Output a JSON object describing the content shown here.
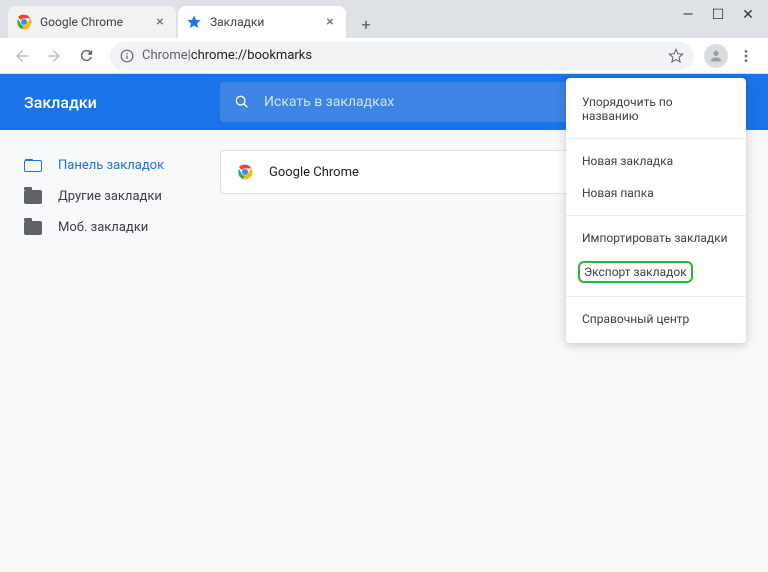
{
  "tabs": [
    {
      "title": "Google Chrome",
      "active": false
    },
    {
      "title": "Закладки",
      "active": true
    }
  ],
  "omnibox": {
    "prefix": "Chrome",
    "separator": " | ",
    "path": "chrome://bookmarks"
  },
  "bookmarksPage": {
    "title": "Закладки",
    "searchPlaceholder": "Искать в закладках"
  },
  "sidebar": {
    "items": [
      {
        "label": "Панель закладок",
        "active": true
      },
      {
        "label": "Другие закладки",
        "active": false
      },
      {
        "label": "Моб. закладки",
        "active": false
      }
    ]
  },
  "bookmarkList": [
    {
      "title": "Google Chrome"
    }
  ],
  "menu": {
    "sortByName": "Упорядочить по названию",
    "newBookmark": "Новая закладка",
    "newFolder": "Новая папка",
    "importBookmarks": "Импортировать закладки",
    "exportBookmarks": "Экспорт закладок",
    "helpCenter": "Справочный центр"
  }
}
